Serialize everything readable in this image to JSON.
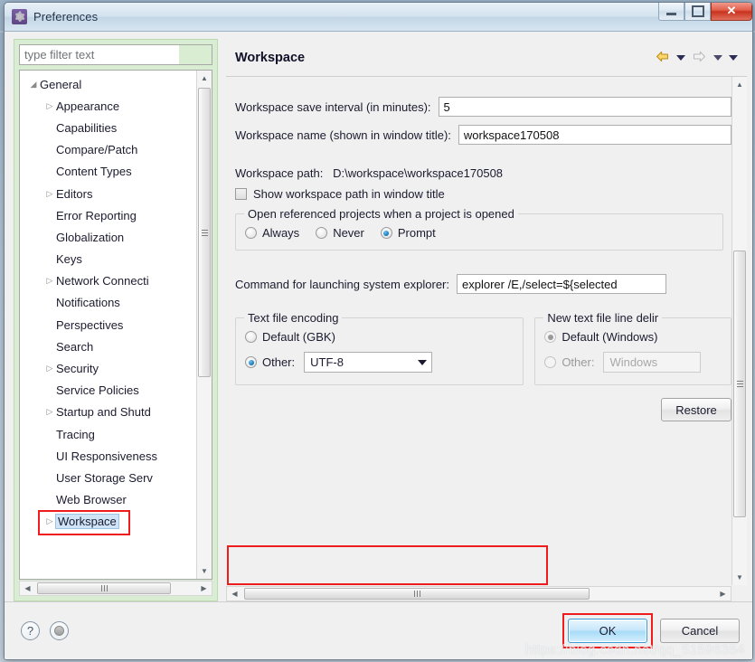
{
  "window": {
    "title": "Preferences",
    "icon": "gear-icon",
    "controls": {
      "minimize": "minimize-icon",
      "maximize": "maximize-icon",
      "close": "✕"
    }
  },
  "filter": {
    "placeholder": "type filter text",
    "value": ""
  },
  "tree": {
    "items": [
      {
        "label": "General",
        "level": 1,
        "twisty": "expanded",
        "selected": false
      },
      {
        "label": "Appearance",
        "level": 2,
        "twisty": "collapsed",
        "selected": false
      },
      {
        "label": "Capabilities",
        "level": 2,
        "twisty": "none",
        "selected": false
      },
      {
        "label": "Compare/Patch",
        "level": 2,
        "twisty": "none",
        "selected": false
      },
      {
        "label": "Content Types",
        "level": 2,
        "twisty": "none",
        "selected": false
      },
      {
        "label": "Editors",
        "level": 2,
        "twisty": "collapsed",
        "selected": false
      },
      {
        "label": "Error Reporting",
        "level": 2,
        "twisty": "none",
        "selected": false
      },
      {
        "label": "Globalization",
        "level": 2,
        "twisty": "none",
        "selected": false
      },
      {
        "label": "Keys",
        "level": 2,
        "twisty": "none",
        "selected": false
      },
      {
        "label": "Network Connecti",
        "level": 2,
        "twisty": "collapsed",
        "selected": false
      },
      {
        "label": "Notifications",
        "level": 2,
        "twisty": "none",
        "selected": false
      },
      {
        "label": "Perspectives",
        "level": 2,
        "twisty": "none",
        "selected": false
      },
      {
        "label": "Search",
        "level": 2,
        "twisty": "none",
        "selected": false
      },
      {
        "label": "Security",
        "level": 2,
        "twisty": "collapsed",
        "selected": false
      },
      {
        "label": "Service Policies",
        "level": 2,
        "twisty": "none",
        "selected": false
      },
      {
        "label": "Startup and Shutd",
        "level": 2,
        "twisty": "collapsed",
        "selected": false
      },
      {
        "label": "Tracing",
        "level": 2,
        "twisty": "none",
        "selected": false
      },
      {
        "label": "UI Responsiveness",
        "level": 2,
        "twisty": "none",
        "selected": false
      },
      {
        "label": "User Storage Serv",
        "level": 2,
        "twisty": "none",
        "selected": false
      },
      {
        "label": "Web Browser",
        "level": 2,
        "twisty": "none",
        "selected": false
      },
      {
        "label": "Workspace",
        "level": 2,
        "twisty": "collapsed",
        "selected": true
      }
    ]
  },
  "page": {
    "title": "Workspace",
    "nav": {
      "back": "back-arrow-icon",
      "back_menu": "chevron-down-icon",
      "forward": "forward-arrow-icon",
      "forward_menu": "chevron-down-icon",
      "view_menu": "chevron-down-icon"
    },
    "save_interval": {
      "label": "Workspace save interval (in minutes):",
      "value": "5"
    },
    "workspace_name": {
      "label": "Workspace name (shown in window title):",
      "value": "workspace170508"
    },
    "workspace_path": {
      "label": "Workspace path:",
      "value": "D:\\workspace\\workspace170508"
    },
    "show_path_checkbox": {
      "label": "Show workspace path in window title",
      "checked": false
    },
    "referenced_projects": {
      "title": "Open referenced projects when a project is opened",
      "options": [
        {
          "label": "Always",
          "selected": false
        },
        {
          "label": "Never",
          "selected": false
        },
        {
          "label": "Prompt",
          "selected": true
        }
      ]
    },
    "command_explorer": {
      "label": "Command for launching system explorer:",
      "value": "explorer /E,/select=${selected"
    },
    "text_file_encoding": {
      "title": "Text file encoding",
      "default_option": {
        "label": "Default (GBK)",
        "selected": false
      },
      "other_option": {
        "label": "Other:",
        "selected": true
      },
      "other_value": "UTF-8"
    },
    "line_delimiter": {
      "title": "New text file line delir",
      "default_option": {
        "label": "Default (Windows)",
        "selected": true
      },
      "other_option": {
        "label": "Other:",
        "selected": false
      },
      "other_value": "Windows"
    },
    "restore_button": "Restore"
  },
  "footer": {
    "help_icon": "?",
    "apply_icon": "apply-dot-icon",
    "ok_button": "OK",
    "cancel_button": "Cancel"
  },
  "watermark": "https://blog.csdn.net/qq_51596354",
  "colors": {
    "tree_panel": "#d9edd2",
    "annotation_red": "#ee1c1c",
    "selection_blue": "#cfe4f7",
    "primary_button": "#a9dcf8",
    "close_button": "#c9331f"
  }
}
